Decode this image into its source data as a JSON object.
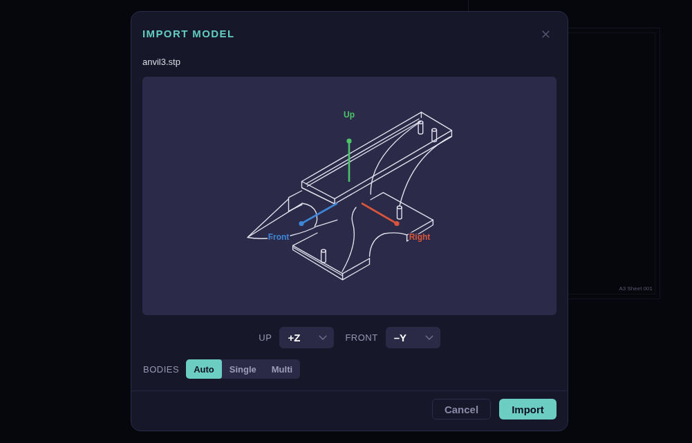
{
  "background": {
    "sheet_label": "A3 Sheet 001"
  },
  "dialog": {
    "title": "IMPORT MODEL",
    "file_name": "anvil3.stp",
    "preview": {
      "axes": [
        {
          "label": "Up",
          "color": "#4ec46a"
        },
        {
          "label": "Front",
          "color": "#3e86d6"
        },
        {
          "label": "Right",
          "color": "#d8553b"
        }
      ]
    },
    "orientation": [
      {
        "label": "UP",
        "value": "+Z"
      },
      {
        "label": "FRONT",
        "value": "–Y"
      }
    ],
    "bodies": {
      "label": "BODIES",
      "options": [
        {
          "label": "Auto",
          "selected": true
        },
        {
          "label": "Single",
          "selected": false
        },
        {
          "label": "Multi",
          "selected": false
        }
      ]
    },
    "buttons": [
      {
        "label": "Cancel",
        "kind": "secondary"
      },
      {
        "label": "Import",
        "kind": "primary"
      }
    ]
  }
}
